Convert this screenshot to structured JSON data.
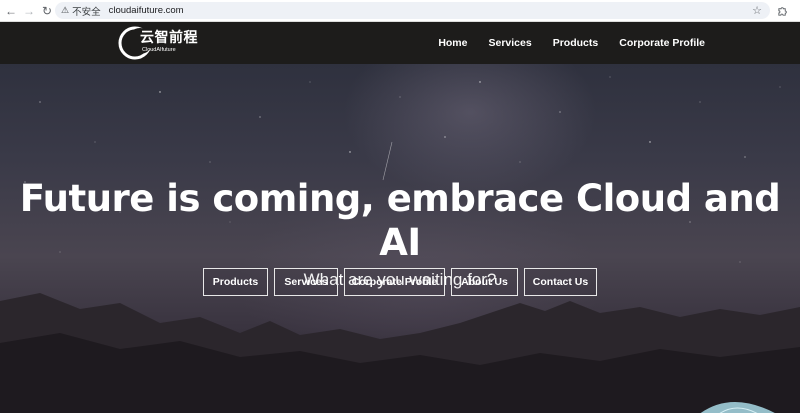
{
  "browser": {
    "back_icon": "arrow-left-icon",
    "forward_icon": "arrow-right-icon",
    "reload_icon": "reload-icon",
    "security_label": "不安全",
    "url": "cloudaifuture.com",
    "bookmark_icon": "star-icon",
    "extensions_icon": "puzzle-icon"
  },
  "site": {
    "logo": {
      "cn": "云智前程",
      "en": "CloudAIfuture"
    },
    "nav": [
      "Home",
      "Services",
      "Products",
      "Corporate Profile"
    ],
    "hero": {
      "title": "Future is coming, embrace Cloud and AI",
      "subtitle": "What are you waiting for?",
      "buttons": [
        "Products",
        "Services",
        "Corporate Profile",
        "About Us",
        "Contact Us"
      ]
    }
  },
  "colors": {
    "header_bg": "#1d1c1b",
    "text": "#ffffff",
    "button_border": "#e8e8e8"
  }
}
